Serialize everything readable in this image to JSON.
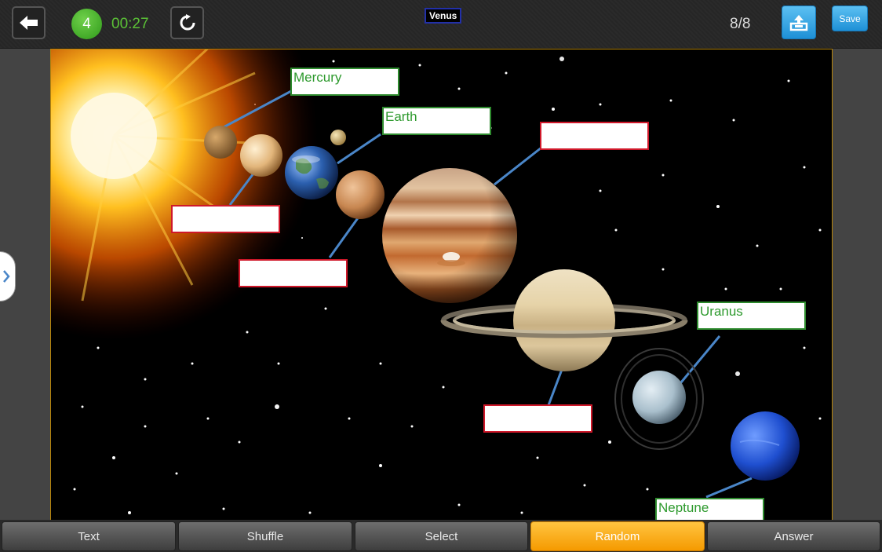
{
  "header": {
    "score": "4",
    "timer": "00:27",
    "current_label": "Venus",
    "progress": "8/8",
    "save_label": "Save"
  },
  "labels": {
    "mercury": "Mercury",
    "earth": "Earth",
    "uranus": "Uranus",
    "neptune": "Neptune",
    "venus_slot": "",
    "mars_slot": "",
    "jupiter_slot": "",
    "saturn_slot": ""
  },
  "toolbar": {
    "tabs": [
      {
        "label": "Text"
      },
      {
        "label": "Shuffle"
      },
      {
        "label": "Select"
      },
      {
        "label": "Random",
        "active": true
      },
      {
        "label": "Answer"
      }
    ]
  },
  "colors": {
    "accent_blue": "#1e90d6",
    "active_tab": "#f59a00",
    "correct_green": "#2e8b2e",
    "empty_red": "#d0182a"
  }
}
